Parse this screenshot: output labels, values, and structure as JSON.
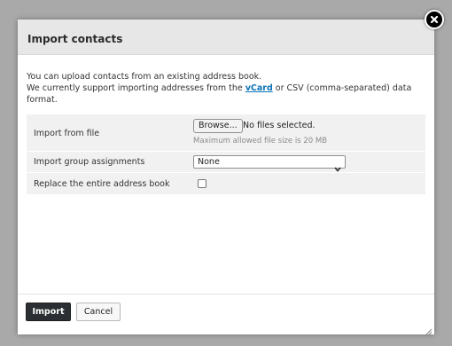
{
  "dialog": {
    "title": "Import contacts",
    "intro_line1": "You can upload contacts from an existing address book.",
    "intro_line2_before": "We currently support importing addresses from the ",
    "intro_link": "vCard",
    "intro_line2_after": " or CSV (comma-separated) data format.",
    "close_icon": "close-icon"
  },
  "form": {
    "file": {
      "label": "Import from file",
      "browse_label": "Browse...",
      "status": "No files selected.",
      "hint": "Maximum allowed file size is 20 MB"
    },
    "group": {
      "label": "Import group assignments",
      "selected": "None"
    },
    "replace": {
      "label": "Replace the entire address book",
      "checked": false
    }
  },
  "footer": {
    "import_label": "Import",
    "cancel_label": "Cancel"
  },
  "colors": {
    "titlebar": "#e7e7e7",
    "row_bg": "#f1f1f1",
    "link": "#0b73b8",
    "primary_button": "#2b2f33"
  }
}
